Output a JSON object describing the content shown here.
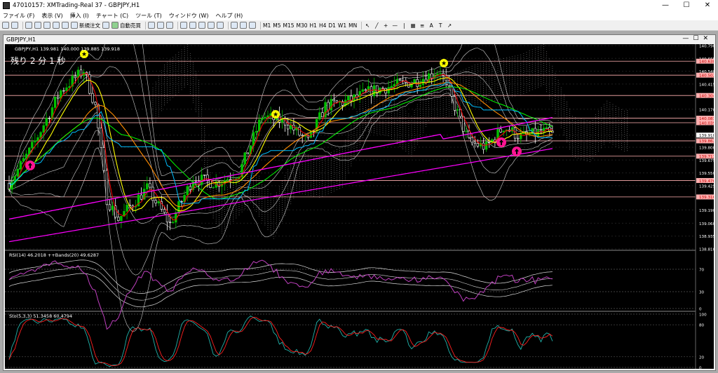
{
  "window": {
    "title": "47010157: XMTrading-Real 37 - GBPJPY,H1",
    "min": "—",
    "max": "☐",
    "close": "✕"
  },
  "menu": [
    "ファイル (F)",
    "表示 (V)",
    "挿入 (I)",
    "チャート (C)",
    "ツール (T)",
    "ウィンドウ (W)",
    "ヘルプ (H)"
  ],
  "toolbar": {
    "new_order": "新規注文",
    "auto_trade": "自動売買",
    "timeframes": [
      "M1",
      "M5",
      "M15",
      "M30",
      "H1",
      "H4",
      "D1",
      "W1",
      "MN"
    ]
  },
  "chart": {
    "tab_title": "GBPJPY,H1",
    "info_line": "GBPJPY,H1   139.981 140.000 139.885 139.918",
    "countdown": "残り 2 分 1 秒",
    "price_levels": [
      {
        "label": "140.790",
        "value": 140.79
      },
      {
        "label": "140.665",
        "value": 140.665
      },
      {
        "label": "140.540",
        "value": 140.54
      },
      {
        "label": "140.415",
        "value": 140.415
      },
      {
        "label": "140.170",
        "value": 140.17
      },
      {
        "label": "139.918",
        "value": 139.918
      },
      {
        "label": "139.800",
        "value": 139.8
      },
      {
        "label": "139.675",
        "value": 139.675
      },
      {
        "label": "139.550",
        "value": 139.55
      },
      {
        "label": "139.425",
        "value": 139.425
      },
      {
        "label": "139.190",
        "value": 139.19
      },
      {
        "label": "139.060",
        "value": 139.06
      },
      {
        "label": "138.935",
        "value": 138.935
      },
      {
        "label": "138.810",
        "value": 138.81
      }
    ],
    "hlines": [
      {
        "label": "140.638",
        "value": 140.638
      },
      {
        "label": "140.502",
        "value": 140.502
      },
      {
        "label": "140.304",
        "value": 140.304
      },
      {
        "label": "140.083",
        "value": 140.083
      },
      {
        "label": "140.039",
        "value": 140.039
      },
      {
        "label": "139.862",
        "value": 139.862
      },
      {
        "label": "139.713",
        "value": 139.713
      },
      {
        "label": "139.476",
        "value": 139.476
      },
      {
        "label": "139.316",
        "value": 139.316
      }
    ],
    "current_price": {
      "label": "139.918",
      "value": 139.918
    },
    "ymin": 138.81,
    "ymax": 140.79
  },
  "rsi": {
    "label": "RSI(14) 46.2018   ++Bands(20) 49.6287",
    "levels": [
      {
        "label": "70",
        "value": 70
      },
      {
        "label": "30",
        "value": 30
      },
      {
        "label": "0",
        "value": 0
      }
    ],
    "ymin": 0,
    "ymax": 100
  },
  "stoch": {
    "label": "Sto(5,3,3) 51.3458 60.4794",
    "levels": [
      {
        "label": "100",
        "value": 100
      },
      {
        "label": "80",
        "value": 80
      },
      {
        "label": "20",
        "value": 20
      },
      {
        "label": "0",
        "value": 0
      }
    ],
    "ymin": 0,
    "ymax": 100
  },
  "colors": {
    "bg": "#000000",
    "bull": "#00c000",
    "bear": "#ffffff",
    "ma_red": "#ff0000",
    "ma_yellow": "#ffff00",
    "ma_orange": "#ff8c00",
    "ma_green": "#00ff00",
    "ma_cyan": "#00bfff",
    "ma_magenta": "#ff00ff",
    "bands": "#d0d0d0",
    "hline": "#ffb0b0",
    "star": "#ffff00",
    "arrow": "#ff1493"
  }
}
